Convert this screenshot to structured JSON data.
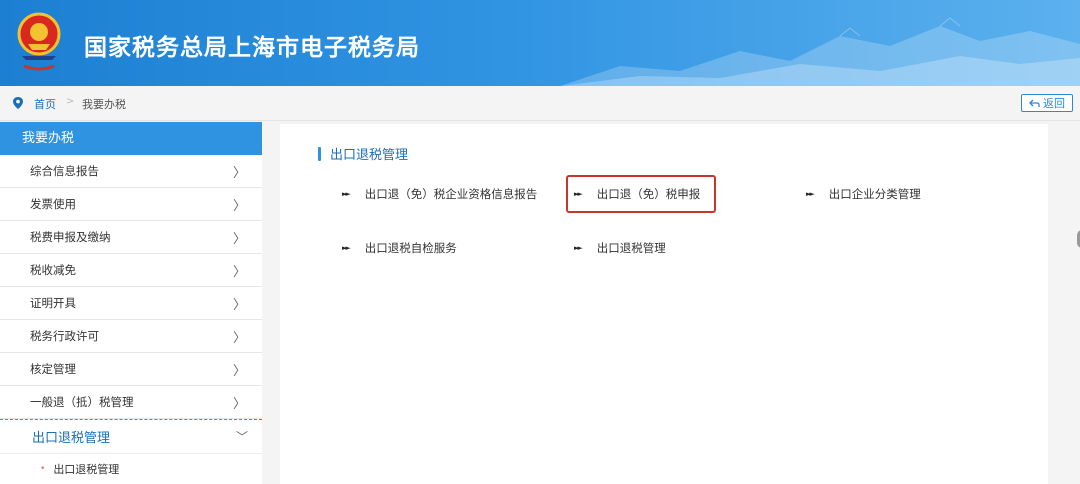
{
  "header": {
    "title": "国家税务总局上海市电子税务局"
  },
  "breadcrumb": {
    "home": "首页",
    "separator": ">",
    "current": "我要办税",
    "back_label": "返回"
  },
  "sidebar": {
    "heading": "我要办税",
    "items": [
      {
        "label": "综合信息报告"
      },
      {
        "label": "发票使用"
      },
      {
        "label": "税费申报及缴纳"
      },
      {
        "label": "税收减免"
      },
      {
        "label": "证明开具"
      },
      {
        "label": "税务行政许可"
      },
      {
        "label": "核定管理"
      },
      {
        "label": "一般退（抵）税管理"
      }
    ],
    "active_item": "出口退税管理",
    "sub_items": [
      {
        "label": "出口退税管理"
      }
    ]
  },
  "main": {
    "section_title": "出口退税管理",
    "links": [
      {
        "label": "出口退（免）税企业资格信息报告"
      },
      {
        "label": "出口退（免）税申报"
      },
      {
        "label": "出口企业分类管理"
      },
      {
        "label": "出口退税自检服务"
      },
      {
        "label": "出口退税管理"
      }
    ]
  },
  "colors": {
    "brand_blue": "#2f93e2",
    "link_blue": "#1a6fb8",
    "highlight_red": "#c8352a"
  }
}
